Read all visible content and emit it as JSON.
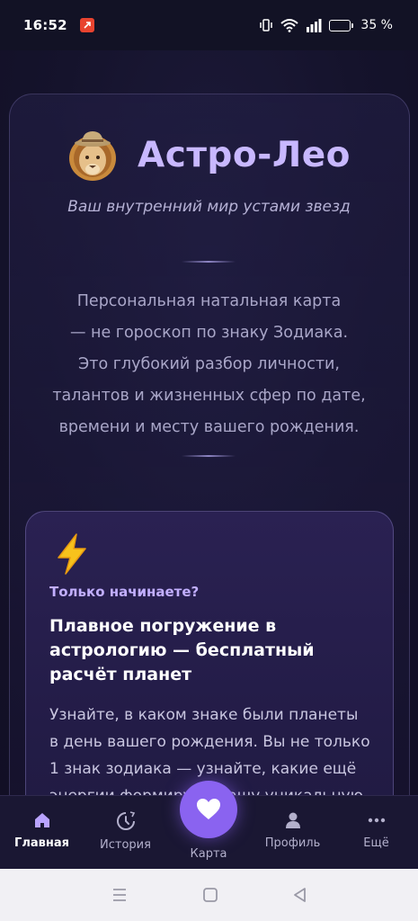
{
  "status_bar": {
    "time": "16:52",
    "battery_percent": "35 %",
    "battery_level": 0.35,
    "icons": [
      "notification-app-icon",
      "vibrate-icon",
      "wifi-icon",
      "signal-icon",
      "battery-icon"
    ]
  },
  "brand": {
    "logo": "lion-logo",
    "title": "Астро-Лео",
    "tagline": "Ваш внутренний мир устами звезд",
    "title_color": "#c8b8ff"
  },
  "intro": {
    "lines": [
      "Персональная натальная карта",
      "— не гороскоп по знаку Зодиака.",
      "Это глубокий разбор личности,",
      "талантов и жизненных сфер по дате,",
      "времени и месту вашего рождения."
    ]
  },
  "feature_card": {
    "icon": "lightning-icon",
    "eyebrow": "Только начинаете?",
    "title": "Плавное погружение в астрологию — бесплатный расчёт планет",
    "text": "Узнайте, в каком знаке были планеты в день вашего рождения. Вы не только 1 знак зодиака — узнайте, какие ещё энергии формируют вашу уникальную",
    "accent_color": "#c2afff"
  },
  "bottom_nav": {
    "items": [
      {
        "label": "Главная",
        "icon": "home-icon",
        "active": true
      },
      {
        "label": "История",
        "icon": "history-icon",
        "active": false
      },
      {
        "label": "Карта",
        "icon": "heart-icon",
        "active": false
      },
      {
        "label": "Профиль",
        "icon": "profile-icon",
        "active": false
      },
      {
        "label": "Ещё",
        "icon": "more-icon",
        "active": false
      }
    ],
    "fab_color": "#8a63f0"
  },
  "system_nav": {
    "icons": [
      "recents-icon",
      "home-button-icon",
      "back-icon"
    ]
  }
}
